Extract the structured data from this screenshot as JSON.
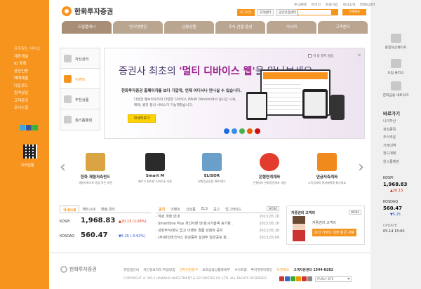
{
  "brand": {
    "name": "한화투자증권"
  },
  "util_links": [
    "주식매매",
    "아이디",
    "회원가입",
    "회사소개",
    "ENGLISH"
  ],
  "top_buttons": [
    "로그아웃",
    "고객센터",
    "공인인증센터"
  ],
  "menu_button": "전체메뉴",
  "gnb": [
    "드림플래너",
    "인터넷뱅킹",
    "금융상품",
    "주식·선물·옵션",
    "리서치",
    "고객센터"
  ],
  "left_bar": {
    "title": "자주찾는 서비스",
    "items": [
      "계좌개설",
      "ID 등록",
      "공인인증",
      "매매체결",
      "다운로드",
      "원격상담",
      "고객문의",
      "오시는길"
    ],
    "mobile": "모바일웹"
  },
  "left_menu": [
    "자산관리",
    "이벤트",
    "추천상품",
    "원스톱뱅킹"
  ],
  "banner": {
    "check": "이 창 열지 않음",
    "title_pre": "증권사 최초의 ",
    "title_hl": "'멀티 디바이스 웹'",
    "title_post": "을 만나보세요",
    "desc1": "한화투자증권 홈페이지를 보다 가깝게, 언제 어디서나 만나실 수 있습니다.",
    "desc2": "다양한 웹브라우저와 다양한 디바이스 (Multi Device)에서 실시간 시세, 매매, 뱅킹 등의 서비스가 가능해졌습니다.",
    "button": "자세히보기"
  },
  "products": [
    {
      "title": "한화 재형저축펀드",
      "desc": "재형저축으로 평생 목돈 마련",
      "color": "#d9a441"
    },
    {
      "title": "Smart M",
      "desc": "빠르고 편리한 스마트폰 어플",
      "color": "#2b2b2b"
    },
    {
      "title": "ELISOR",
      "desc": "한화증권상품 PB브랜드",
      "color": "#6a9fc9"
    },
    {
      "title": "은행연계계좌",
      "desc": "은행에서 한화증권계좌 개설",
      "color": "#e23c2c"
    },
    {
      "title": "연금저축계좌",
      "desc": "소득공제의 절세혜택을 챙기세요",
      "color": "#f08a1c"
    }
  ],
  "market": {
    "tabs": [
      "국내시세",
      "해외시세",
      "환율·금리"
    ],
    "rows": [
      {
        "name": "KOSPI",
        "value": "1,968.83",
        "change": "▲20.13 (1.03%)",
        "dir": "up"
      },
      {
        "name": "KOSDAQ",
        "value": "560.47",
        "change": "▼5.25 (-0.93%)",
        "dir": "dn"
      }
    ]
  },
  "news": {
    "tabs": [
      "공지",
      "이벤트",
      "신상품",
      "ELS",
      "공고",
      "업그레이드"
    ],
    "more": "MORE",
    "items": [
      {
        "t": "· 약관 개정 안내",
        "d": "2013.05.10"
      },
      {
        "t": "· SmartOne Plus 개선사항 안내(시가총액 표기항..",
        "d": "2013.05.10"
      },
      {
        "t": "· 상장주식/펀드 입고 이벤트 경품 당첨자 공지",
        "d": "2013.05.10"
      },
      {
        "t": "· (주)파인테크닉스 유상증자 실권주 일반공모 청..",
        "d": "2013.05.09"
      }
    ]
  },
  "pb": {
    "title": "자증권의 고객의",
    "more": "MORE",
    "line1": "자증권의 고객의",
    "line2": "보다 가까이 대한 원금 사랑"
  },
  "right": {
    "quick": [
      "종합자산페이지",
      "드림 플러스",
      "한화금융 네트워크"
    ],
    "title": "바로가기",
    "links": [
      "나의자산",
      "관심종목",
      "주식주문",
      "거래내역",
      "펀드매매",
      "원스톱뱅킹"
    ],
    "idx": [
      {
        "name": "KOSPI",
        "value": "1,968.83",
        "change": "▲20.13",
        "dir": "up"
      },
      {
        "name": "KOSDAQ",
        "value": "560.47",
        "change": "▼5.25",
        "dir": "dn"
      }
    ],
    "update_label": "UPDATE",
    "update": "05-14 15:00"
  },
  "footer": {
    "logo": "한화투자증권",
    "links": [
      "영업점안내",
      "개인정보처리·취급방침",
      "전자민원창구",
      "보호금융상품등록부",
      "사이트맵",
      "투자권유대행인",
      "다운로드",
      "고객지원센터 1544-8282"
    ],
    "copyright": "COPYRIGHT © 2013 HANWHA INVESTMENT & SECURITIES CO.,LTD. ALL RIGHTS RESERVED.",
    "family": "FAMILY SITE"
  },
  "colors": {
    "brand_orange": "#f7941d",
    "tab_brown": "#b9a590",
    "up": "#dd2200",
    "down": "#2255cc"
  }
}
